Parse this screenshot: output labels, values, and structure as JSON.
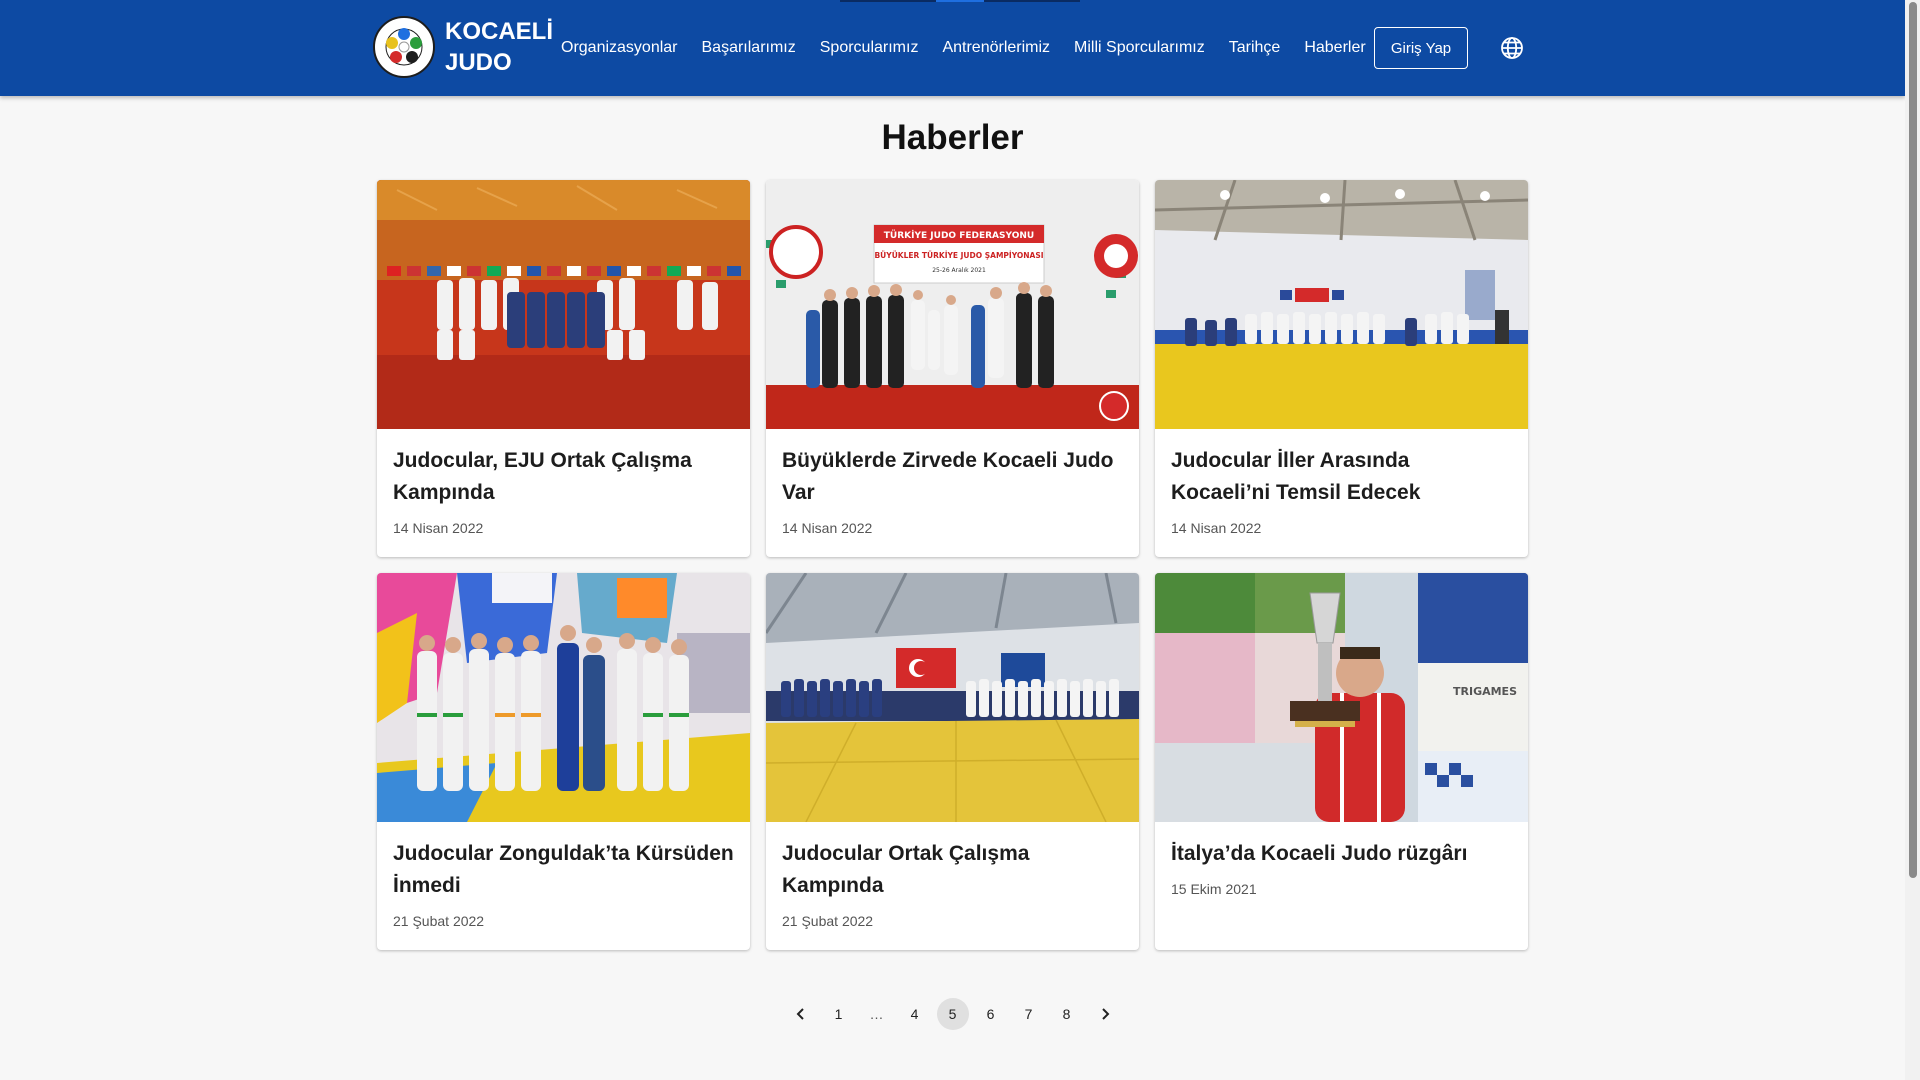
{
  "brand": {
    "line1": "KOCAELİ",
    "line2": "JUDO"
  },
  "nav": {
    "items": [
      "Organizasyonlar",
      "Başarılarımız",
      "Sporcularımız",
      "Antrenörlerimiz",
      "Milli Sporcularımız",
      "Tarihçe",
      "Haberler"
    ],
    "login_label": "Giriş Yap",
    "language_icon": "globe-icon"
  },
  "page": {
    "title": "Haberler"
  },
  "cards": [
    {
      "title": "Judocular, EJU Ortak Çalışma Kampında",
      "date": "14 Nisan 2022"
    },
    {
      "title": "Büyüklerde Zirvede Kocaeli Judo Var",
      "date": "14 Nisan 2022"
    },
    {
      "title": "Judocular İller Arasında Kocaeli’ni Temsil Edecek",
      "date": "14 Nisan 2022"
    },
    {
      "title": "Judocular Zonguldak’ta Kürsüden İnmedi",
      "date": "21 Şubat 2022"
    },
    {
      "title": "Judocular Ortak Çalışma Kampında",
      "date": "21 Şubat 2022"
    },
    {
      "title": "İtalya’da Kocaeli Judo rüzgârı",
      "date": "15 Ekim 2021"
    }
  ],
  "image_text": {
    "banner_line1": "TÜRKİYE JUDO FEDERASYONU",
    "banner_line2": "BÜYÜKLER TÜRKİYE JUDO ŞAMPİYONASI",
    "banner_line3": "25-26 Aralık 2021",
    "trigames": "TRIGAMES"
  },
  "pagination": {
    "prev_icon": "chevron-left-icon",
    "pages": [
      "1",
      "…",
      "4",
      "5",
      "6",
      "7",
      "8"
    ],
    "current": "5",
    "next_icon": "chevron-right-icon"
  },
  "colors": {
    "header_bg": "#0d4aa3",
    "page_bg": "#f7f7f7",
    "active_page_bg": "#e0e0e0"
  }
}
